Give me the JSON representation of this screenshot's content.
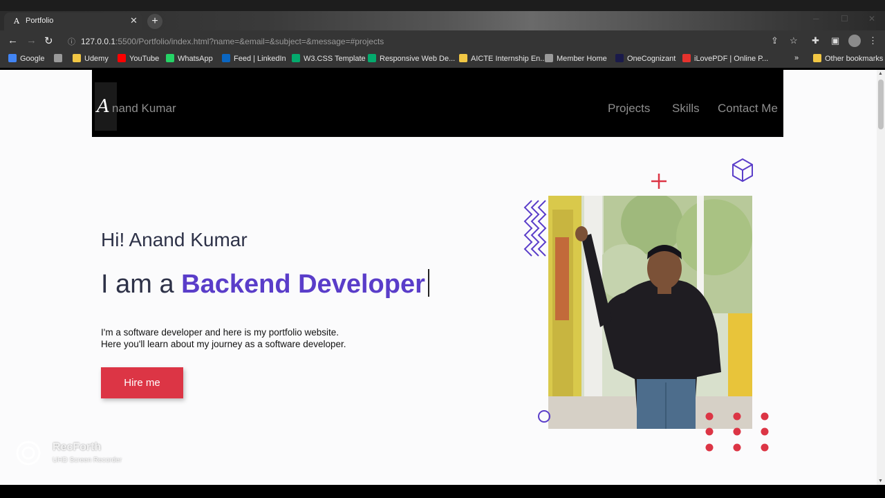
{
  "browser": {
    "tab": {
      "favicon": "A",
      "title": "Portfolio",
      "close": "✕"
    },
    "new_tab": "+",
    "url": {
      "host": "127.0.0.1",
      "rest": ":5500/Portfolio/index.html?name=&email=&subject=&message=#projects"
    },
    "bookmarks": [
      {
        "label": "Google",
        "color": "#4285f4"
      },
      {
        "label": "",
        "color": "#9a9a9a"
      },
      {
        "label": "Udemy",
        "color": "#f2c744"
      },
      {
        "label": "YouTube",
        "color": "#ff0000"
      },
      {
        "label": "WhatsApp",
        "color": "#25d366"
      },
      {
        "label": "Feed | LinkedIn",
        "color": "#0a66c2"
      },
      {
        "label": "W3.CSS Template",
        "color": "#04aa6d"
      },
      {
        "label": "Responsive Web De...",
        "color": "#04aa6d"
      },
      {
        "label": "AICTE Internship En...",
        "color": "#f2c744"
      },
      {
        "label": "Member Home",
        "color": "#9a9a9a"
      },
      {
        "label": "OneCognizant",
        "color": "#1a1a4a"
      },
      {
        "label": "iLovePDF | Online P...",
        "color": "#e5322d"
      }
    ],
    "bookmarks_overflow": "»",
    "other_bookmarks": "Other bookmarks"
  },
  "site": {
    "logo_letter": "A",
    "logo_name": "nand Kumar",
    "menu": [
      "Projects",
      "Skills",
      "Contact Me"
    ]
  },
  "hero": {
    "greeting": "Hi! Anand Kumar",
    "role_prefix": "I am a ",
    "role_accent": "Backend Developer",
    "desc_line1": "I'm a software developer and here is my portfolio website.",
    "desc_line2": "Here you'll learn about my journey as a software developer.",
    "cta": "Hire me"
  },
  "colors": {
    "accent": "#5a3dc9",
    "button": "#dc3545",
    "header_bg": "#000000"
  },
  "watermark": {
    "title": "RecForth",
    "subtitle": "UHD Screen Recorder"
  }
}
